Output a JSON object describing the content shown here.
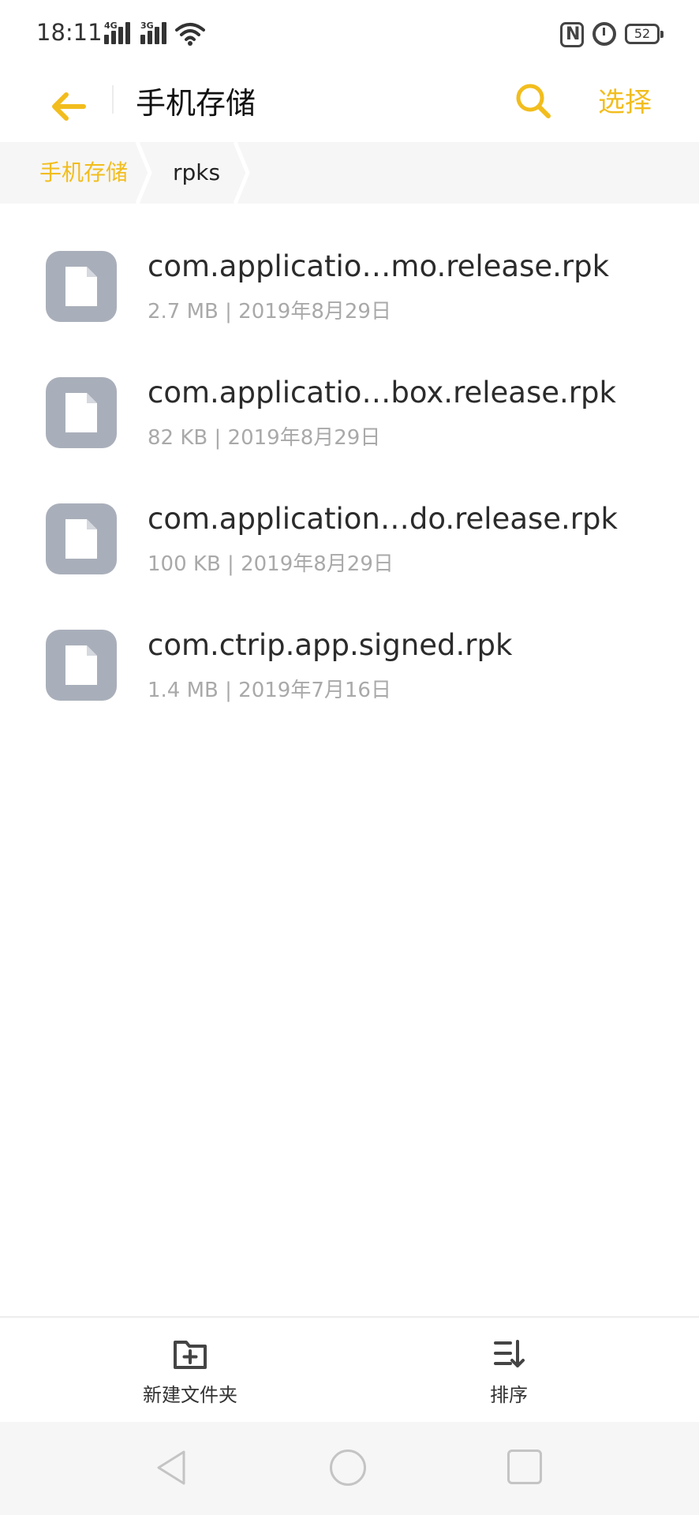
{
  "status_bar": {
    "time": "18:11",
    "network_1": "4G",
    "network_2": "3G",
    "battery": "52",
    "icons": [
      "signal-4g-icon",
      "signal-3g-icon",
      "wifi-icon",
      "nfc-icon",
      "alarm-icon",
      "battery-icon"
    ]
  },
  "header": {
    "title": "手机存储",
    "select_label": "选择",
    "accent_color": "#f2bd1d"
  },
  "breadcrumb": {
    "items": [
      "手机存储",
      "rpks"
    ]
  },
  "files": [
    {
      "name": "com.applicatio…mo.release.rpk",
      "meta": "2.7 MB | 2019年8月29日"
    },
    {
      "name": "com.applicatio…box.release.rpk",
      "meta": "82 KB | 2019年8月29日"
    },
    {
      "name": "com.application…do.release.rpk",
      "meta": "100 KB | 2019年8月29日"
    },
    {
      "name": "com.ctrip.app.signed.rpk",
      "meta": "1.4 MB | 2019年7月16日"
    }
  ],
  "toolbar": {
    "new_folder_label": "新建文件夹",
    "sort_label": "排序"
  }
}
